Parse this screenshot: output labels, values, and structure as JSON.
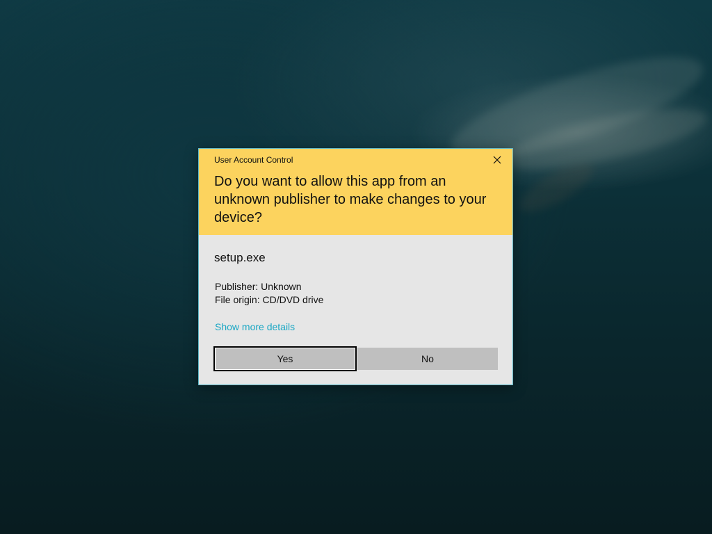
{
  "dialog": {
    "title": "User Account Control",
    "question": "Do you want to allow this app from an unknown publisher to make changes to your device?",
    "app_name": "setup.exe",
    "publisher": "Publisher: Unknown",
    "file_origin": "File origin: CD/DVD drive",
    "details_link": "Show more details",
    "yes_label": "Yes",
    "no_label": "No"
  },
  "icons": {
    "close": "close-icon"
  },
  "colors": {
    "header_bg": "#fcd35e",
    "body_bg": "#e6e6e6",
    "link": "#1aa7c4",
    "button_bg": "#bfbfbf",
    "dialog_border": "#5fb7c7"
  }
}
